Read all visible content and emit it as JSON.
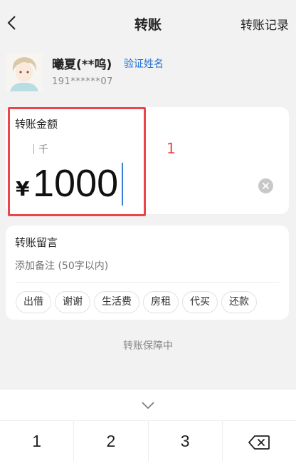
{
  "nav": {
    "title": "转账",
    "records_label": "转账记录"
  },
  "user": {
    "name": "曦夏(**呜)",
    "verify_label": "验证姓名",
    "phone": "191******07"
  },
  "amount": {
    "label": "转账金额",
    "unit_hint": "千",
    "currency": "¥",
    "value": "1000",
    "annotation": "1"
  },
  "note": {
    "label": "转账留言",
    "placeholder": "添加备注 (50字以内)",
    "chips": [
      "出借",
      "谢谢",
      "生活费",
      "房租",
      "代买",
      "还款"
    ]
  },
  "footer": {
    "protect_text": "转账保障中"
  },
  "keyboard": {
    "keys": [
      "1",
      "2",
      "3"
    ]
  },
  "colors": {
    "highlight": "#e8464b",
    "link": "#1f6fd6",
    "caret": "#3b7ddd"
  }
}
